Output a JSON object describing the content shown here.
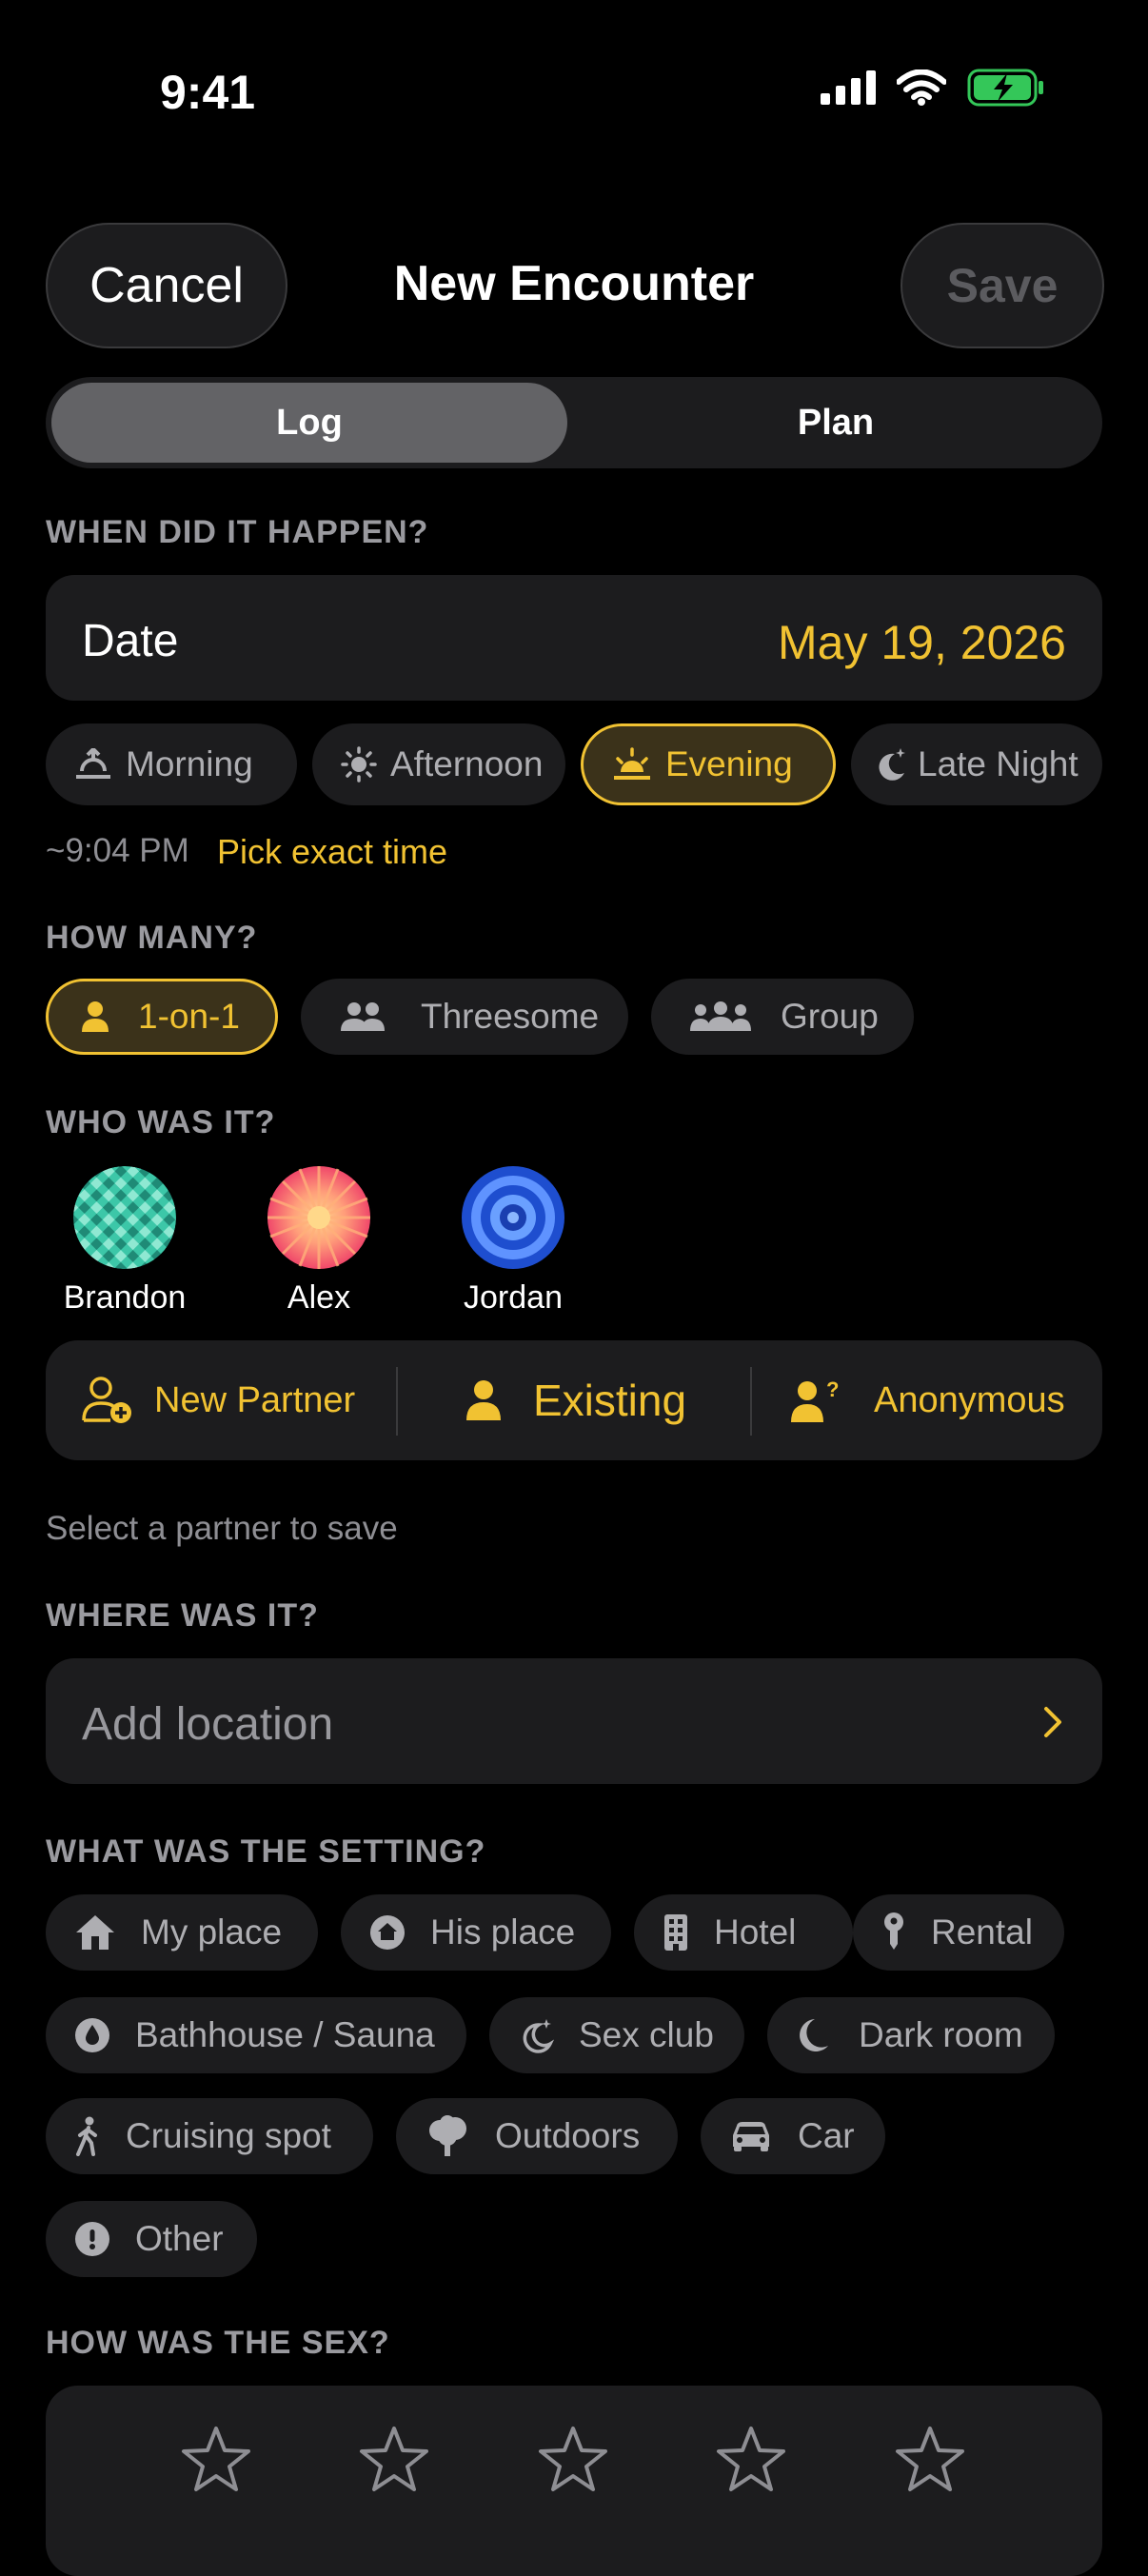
{
  "status_bar": {
    "time": "9:41"
  },
  "header": {
    "cancel_label": "Cancel",
    "title": "New Encounter",
    "save_label": "Save"
  },
  "mode_tabs": {
    "log": "Log",
    "plan": "Plan",
    "selected": "Log"
  },
  "when": {
    "section_label": "WHEN DID IT HAPPEN?",
    "date_label": "Date",
    "date_value": "May 19, 2026",
    "times": [
      "Morning",
      "Afternoon",
      "Evening",
      "Late Night"
    ],
    "selected_time": "Evening",
    "approx_time": "~9:04 PM",
    "pick_exact": "Pick exact time"
  },
  "how_many": {
    "section_label": "HOW MANY?",
    "options": [
      "1-on-1",
      "Threesome",
      "Group"
    ],
    "selected": "1-on-1"
  },
  "who": {
    "section_label": "WHO WAS IT?",
    "partners": [
      "Brandon",
      "Alex",
      "Jordan"
    ],
    "modes": [
      "New Partner",
      "Existing",
      "Anonymous"
    ],
    "hint": "Select a partner to save"
  },
  "where": {
    "section_label": "WHERE WAS IT?",
    "placeholder": "Add location"
  },
  "setting": {
    "section_label": "WHAT WAS THE SETTING?",
    "options": [
      "My place",
      "His place",
      "Hotel",
      "Rental",
      "Bathhouse / Sauna",
      "Sex club",
      "Dark room",
      "Cruising spot",
      "Outdoors",
      "Car",
      "Other"
    ]
  },
  "rating": {
    "section_label": "HOW WAS THE SEX?",
    "max_stars": 5,
    "value": 0
  },
  "colors": {
    "accent": "#f1c232",
    "background": "#000000",
    "card": "#1c1c1e",
    "muted": "#8e8e93"
  }
}
